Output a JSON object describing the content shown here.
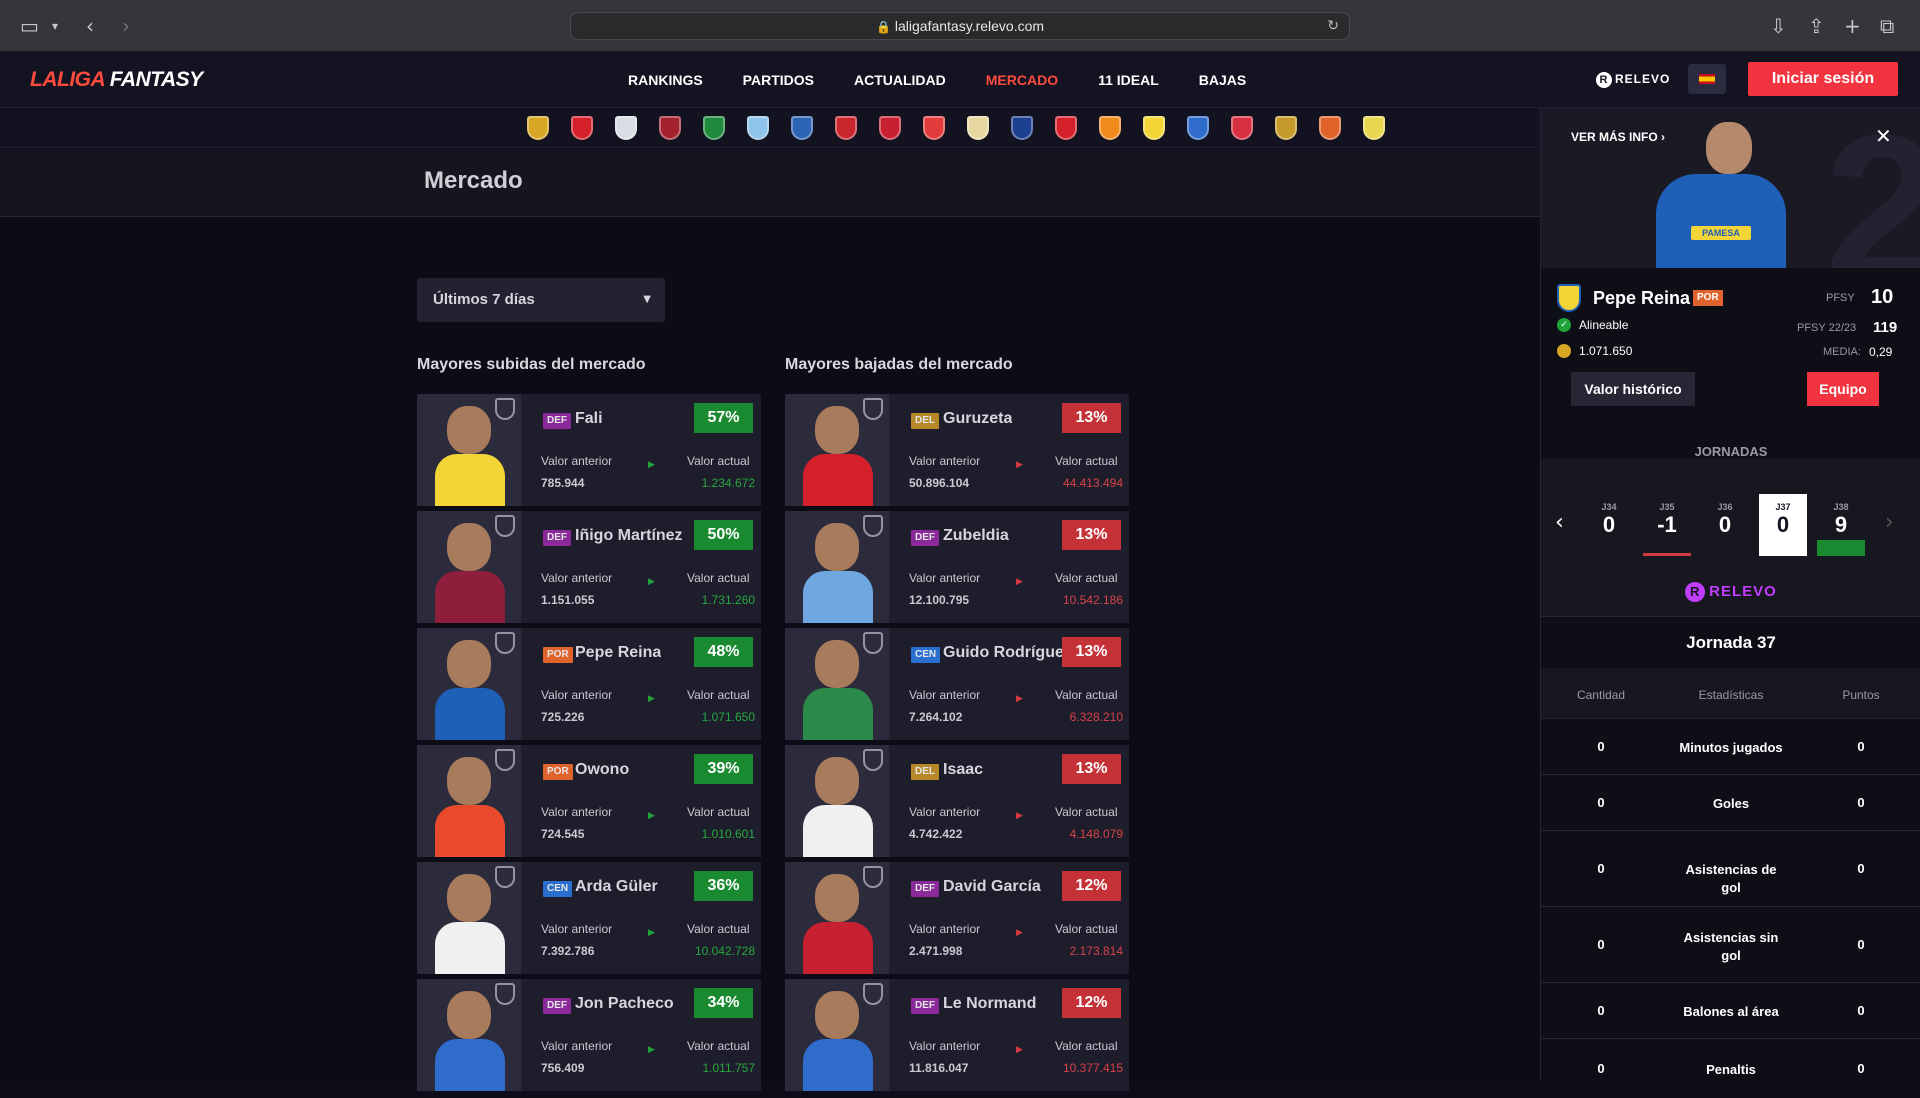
{
  "browser": {
    "url": "laligafantasy.relevo.com"
  },
  "header": {
    "logo_part1": "LALIGA",
    "logo_part2": "FANTASY",
    "nav": [
      "RANKINGS",
      "PARTIDOS",
      "ACTUALIDAD",
      "MERCADO",
      "11 IDEAL",
      "BAJAS"
    ],
    "active_nav": "MERCADO",
    "relevo_label": "RELEVO",
    "login_label": "Iniciar sesión"
  },
  "clubs": {
    "colors": [
      "#d7a624",
      "#d4202b",
      "#d9dde3",
      "#a3222e",
      "#1f8a3b",
      "#8fc5ea",
      "#2d64b3",
      "#c9262e",
      "#c72030",
      "#e23b3b",
      "#e6d7a1",
      "#1d3f8f",
      "#d4202b",
      "#f18a1c",
      "#f3d538",
      "#2f6ccb",
      "#d62f3f",
      "#c59a2a",
      "#e0632b",
      "#e9d64f"
    ]
  },
  "page": {
    "title": "Mercado",
    "filter_value": "Últimos 7 días",
    "col_up_title": "Mayores subidas del mercado",
    "col_down_title": "Mayores bajadas del mercado",
    "label_prev": "Valor anterior",
    "label_now": "Valor actual"
  },
  "risers": [
    {
      "pos": "DEF",
      "name": "Fali",
      "pct": "57%",
      "prev": "785.944",
      "now": "1.234.672",
      "kit": "#f3d538",
      "pos_color": "#8a2a9a"
    },
    {
      "pos": "DEF",
      "name": "Iñigo Martínez",
      "pct": "50%",
      "prev": "1.151.055",
      "now": "1.731.260",
      "kit": "#8e1f3c",
      "pos_color": "#8a2a9a"
    },
    {
      "pos": "POR",
      "name": "Pepe Reina",
      "pct": "48%",
      "prev": "725.226",
      "now": "1.071.650",
      "kit": "#1e5fb8",
      "pos_color": "#e0632b"
    },
    {
      "pos": "POR",
      "name": "Owono",
      "pct": "39%",
      "prev": "724.545",
      "now": "1.010.601",
      "kit": "#e84a2b",
      "pos_color": "#e0632b"
    },
    {
      "pos": "CEN",
      "name": "Arda Güler",
      "pct": "36%",
      "prev": "7.392.786",
      "now": "10.042.728",
      "kit": "#f0f0f0",
      "pos_color": "#2a6fd0"
    },
    {
      "pos": "DEF",
      "name": "Jon Pacheco",
      "pct": "34%",
      "prev": "756.409",
      "now": "1.011.757",
      "kit": "#2f6ccb",
      "pos_color": "#8a2a9a"
    }
  ],
  "fallers": [
    {
      "pos": "DEL",
      "name": "Guruzeta",
      "pct": "13%",
      "prev": "50.896.104",
      "now": "44.413.494",
      "kit": "#d4202b",
      "pos_color": "#b7882a"
    },
    {
      "pos": "DEF",
      "name": "Zubeldia",
      "pct": "13%",
      "prev": "12.100.795",
      "now": "10.542.186",
      "kit": "#6fa7e0",
      "pos_color": "#8a2a9a"
    },
    {
      "pos": "CEN",
      "name": "Guido Rodríguez",
      "pct": "13%",
      "prev": "7.264.102",
      "now": "6.328.210",
      "kit": "#2c8a4a",
      "pos_color": "#2a6fd0"
    },
    {
      "pos": "DEL",
      "name": "Isaac",
      "pct": "13%",
      "prev": "4.742.422",
      "now": "4.148.079",
      "kit": "#f0f0f0",
      "pos_color": "#b7882a"
    },
    {
      "pos": "DEF",
      "name": "David García",
      "pct": "12%",
      "prev": "2.471.998",
      "now": "2.173.814",
      "kit": "#c72030",
      "pos_color": "#8a2a9a"
    },
    {
      "pos": "DEF",
      "name": "Le Normand",
      "pct": "12%",
      "prev": "11.816.047",
      "now": "10.377.415",
      "kit": "#2f6ccb",
      "pos_color": "#8a2a9a"
    }
  ],
  "panel": {
    "more_info": "VER MÁS INFO",
    "player_name": "Pepe Reina",
    "player_pos": "POR",
    "status": "Alineable",
    "value": "1.071.650",
    "pfsy_label": "PFSY",
    "pfsy": "10",
    "pfsy_prev_label": "PFSY 22/23",
    "pfsy_prev": "119",
    "media_label": "MEDIA:",
    "media": "0,29",
    "btn_history": "Valor histórico",
    "btn_team": "Equipo",
    "jornadas_title": "JORNADAS",
    "jornadas": [
      {
        "label": "J34",
        "value": "0",
        "bar": ""
      },
      {
        "label": "J35",
        "value": "-1",
        "bar": "#d43a3f"
      },
      {
        "label": "J36",
        "value": "0",
        "bar": ""
      },
      {
        "label": "J37",
        "value": "0",
        "bar": "",
        "selected": true
      },
      {
        "label": "J38",
        "value": "9",
        "bar": "#1a8a31"
      }
    ],
    "relevo": "RELEVO",
    "jornada_head": "Jornada 37",
    "table_headers": [
      "Cantidad",
      "Estadísticas",
      "Puntos"
    ],
    "stats": [
      {
        "qty": "0",
        "name": "Minutos jugados",
        "pts": "0"
      },
      {
        "qty": "0",
        "name": "Goles",
        "pts": "0"
      },
      {
        "qty": "0",
        "name": "Asistencias de gol",
        "pts": "0"
      },
      {
        "qty": "0",
        "name": "Asistencias sin gol",
        "pts": "0"
      },
      {
        "qty": "0",
        "name": "Balones al área",
        "pts": "0"
      },
      {
        "qty": "0",
        "name": "Penaltis",
        "pts": "0"
      }
    ]
  }
}
